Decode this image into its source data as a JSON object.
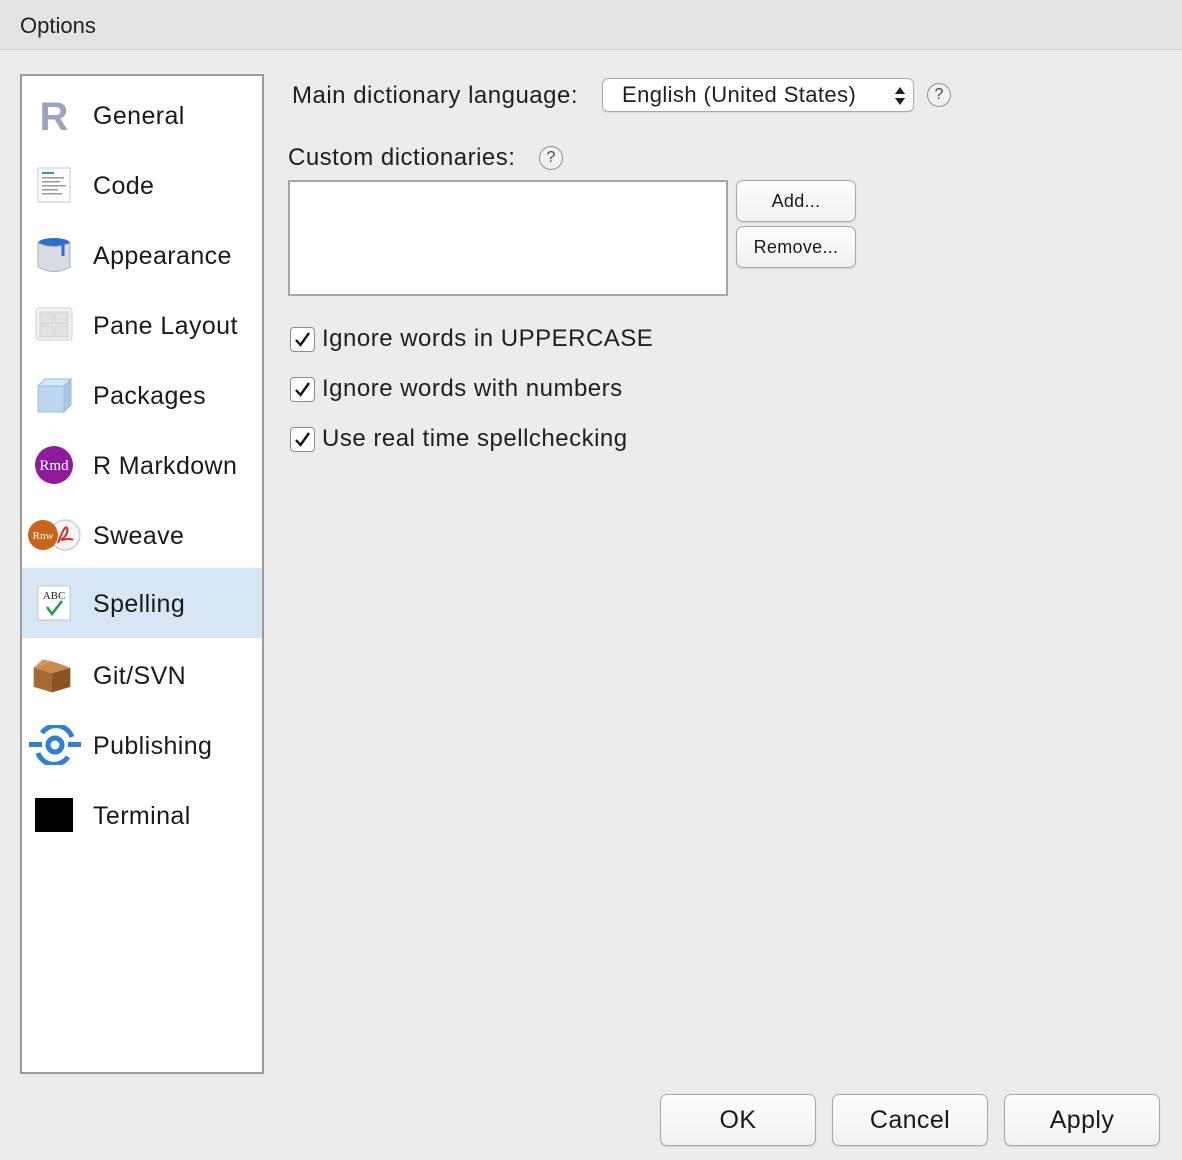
{
  "window": {
    "title": "Options"
  },
  "sidebar": {
    "selected": "Spelling",
    "items": [
      {
        "label": "General",
        "icon": "r-logo-icon"
      },
      {
        "label": "Code",
        "icon": "code-document-icon"
      },
      {
        "label": "Appearance",
        "icon": "paint-bucket-icon"
      },
      {
        "label": "Pane Layout",
        "icon": "pane-grid-icon"
      },
      {
        "label": "Packages",
        "icon": "package-cube-icon"
      },
      {
        "label": "R Markdown",
        "icon": "rmd-icon",
        "icon_text": "Rmd"
      },
      {
        "label": "Sweave",
        "icon": "sweave-pdf-icon",
        "icon_text": "Rnw"
      },
      {
        "label": "Spelling",
        "icon": "abc-check-icon",
        "icon_text": "ABC"
      },
      {
        "label": "Git/SVN",
        "icon": "box-icon"
      },
      {
        "label": "Publishing",
        "icon": "publish-icon"
      },
      {
        "label": "Terminal",
        "icon": "terminal-icon"
      }
    ]
  },
  "spelling": {
    "main_dictionary_label": "Main dictionary language:",
    "main_dictionary_value": "English (United States)",
    "help": "?",
    "custom_dictionaries_label": "Custom dictionaries:",
    "add_label": "Add...",
    "remove_label": "Remove...",
    "checkboxes": [
      {
        "label": "Ignore words in UPPERCASE",
        "checked": true
      },
      {
        "label": "Ignore words with numbers",
        "checked": true
      },
      {
        "label": "Use real time spellchecking",
        "checked": true
      }
    ]
  },
  "footer": {
    "ok_label": "OK",
    "cancel_label": "Cancel",
    "apply_label": "Apply"
  },
  "colors": {
    "selected_bg": "#d6e6f5",
    "publish_blue": "#2f7fd8",
    "rmd_purple": "#8e1b9a",
    "rnw_orange": "#c8651b"
  }
}
